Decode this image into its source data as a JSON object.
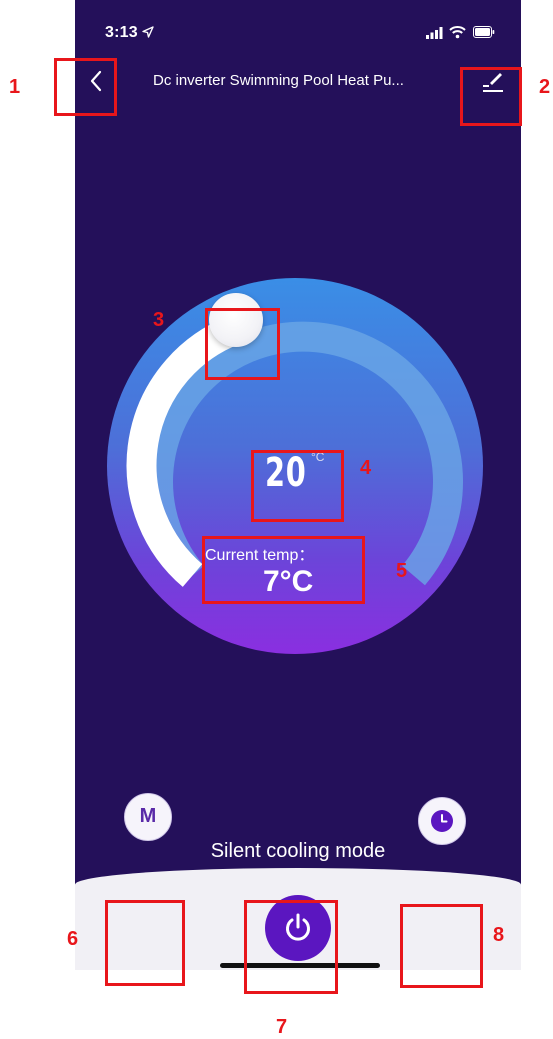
{
  "status_bar": {
    "time": "3:13",
    "icons": [
      "location-arrow-icon",
      "signal-icon",
      "wifi-icon",
      "battery-icon"
    ]
  },
  "nav": {
    "title": "Dc inverter Swimming Pool Heat Pu...",
    "back_icon": "chevron-left-icon",
    "edit_icon": "edit-icon"
  },
  "thermostat": {
    "setpoint": "20",
    "setpoint_unit": "°C",
    "current_temp_label": "Current temp：",
    "current_temp_value": "7°C",
    "mode_text": "Silent cooling mode"
  },
  "controls": {
    "mode_button_label": "M",
    "power_icon": "power-icon",
    "timer_icon": "clock-icon"
  },
  "annotations": [
    "1",
    "2",
    "3",
    "4",
    "5",
    "6",
    "7",
    "8"
  ],
  "colors": {
    "background": "#24105a",
    "accent": "#5b16c0",
    "annotation": "#e8161b",
    "bottom_bar": "#f1f0f5"
  }
}
